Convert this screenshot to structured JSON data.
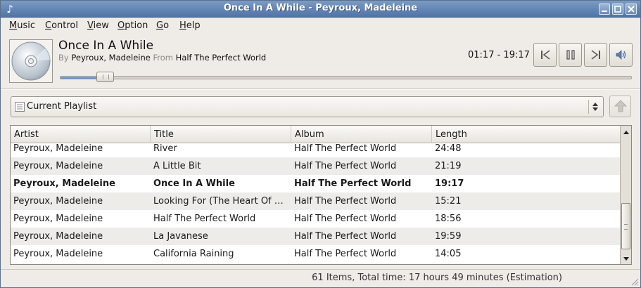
{
  "window": {
    "title": "Once In A While - Peyroux, Madeleine"
  },
  "menu": [
    "Music",
    "Control",
    "View",
    "Option",
    "Go",
    "Help"
  ],
  "now_playing": {
    "title": "Once In A While",
    "by_label": "By",
    "artist": "Peyroux, Madeleine",
    "from_label": "From",
    "album": "Half The Perfect World",
    "time": "01:17 - 19:17",
    "progress": 0.067
  },
  "controls": {
    "previous_icon": "skip-previous-icon",
    "pause_icon": "pause-icon",
    "next_icon": "skip-next-icon",
    "volume_icon": "volume-icon"
  },
  "playlist_selector": {
    "value": "Current Playlist"
  },
  "table": {
    "columns": [
      "Artist",
      "Title",
      "Album",
      "Length"
    ],
    "rows": [
      {
        "artist": "Peyroux, Madeleine",
        "title": "River",
        "album": "Half The Perfect World",
        "length": "24:48"
      },
      {
        "artist": "Peyroux, Madeleine",
        "title": "A Little Bit",
        "album": "Half The Perfect World",
        "length": "21:19"
      },
      {
        "artist": "Peyroux, Madeleine",
        "title": "Once In A While",
        "album": "Half The Perfect World",
        "length": "19:17",
        "playing": true
      },
      {
        "artist": "Peyroux, Madeleine",
        "title": "Looking For (The Heart Of Saturday Night)",
        "album": "Half The Perfect World",
        "length": "15:21"
      },
      {
        "artist": "Peyroux, Madeleine",
        "title": "Half The Perfect World",
        "album": "Half The Perfect World",
        "length": "18:56"
      },
      {
        "artist": "Peyroux, Madeleine",
        "title": "La Javanese",
        "album": "Half The Perfect World",
        "length": "19:59"
      },
      {
        "artist": "Peyroux, Madeleine",
        "title": "California Raining",
        "album": "Half The Perfect World",
        "length": "14:05"
      }
    ]
  },
  "status": "61 Items,  Total time: 17 hours 49 minutes (Estimation)",
  "colors": {
    "titlebar": "#5b7fb0",
    "seek_fill": "#6f98cf",
    "row_alt": "#eeece9"
  }
}
